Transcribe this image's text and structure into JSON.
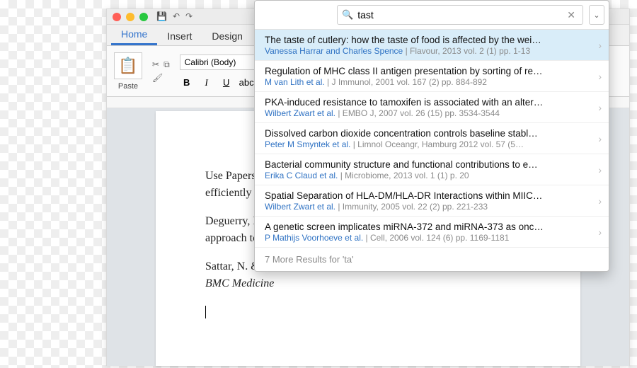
{
  "window": {
    "tabs": [
      "Home",
      "Insert",
      "Design"
    ],
    "active_tab": 0,
    "paste_label": "Paste",
    "font_name": "Calibri (Body)",
    "formats": {
      "bold": "B",
      "italic": "I",
      "underline": "U"
    }
  },
  "document": {
    "p1": "Use Papers an",
    "p2": "efficiently (Na",
    "p3": "Deguerry, M.,",
    "p4": "approach to e",
    "p5": "Sattar, N. & Gi",
    "p6_em": "BMC Medicine"
  },
  "search": {
    "query": "tast",
    "placeholder": "",
    "more_label": "7 More Results for 'ta'"
  },
  "results": [
    {
      "title": "The taste of cutlery: how the taste of food is affected by the wei…",
      "authors": "Vanessa Harrar and Charles Spence",
      "meta": "Flavour, 2013 vol. 2 (1) pp. 1-13",
      "selected": true
    },
    {
      "title": "Regulation of MHC class II antigen presentation by sorting of re…",
      "authors": "M van Lith et al.",
      "meta": "J Immunol, 2001 vol. 167 (2) pp. 884-892"
    },
    {
      "title": "PKA-induced resistance to tamoxifen is associated with an alter…",
      "authors": "Wilbert Zwart et al.",
      "meta": "EMBO J, 2007 vol. 26 (15) pp. 3534-3544"
    },
    {
      "title": "Dissolved carbon dioxide concentration controls baseline stabl…",
      "authors": "Peter M Smyntek et al.",
      "meta": "Limnol Oceangr, Hamburg 2012 vol. 57 (5…"
    },
    {
      "title": "Bacterial community structure and functional contributions to e…",
      "authors": "Erika C Claud et al.",
      "meta": "Microbiome, 2013 vol. 1 (1) p. 20"
    },
    {
      "title": "Spatial Separation of HLA-DM/HLA-DR Interactions within MIIC…",
      "authors": "Wilbert Zwart et al.",
      "meta": "Immunity, 2005 vol. 22 (2) pp. 221-233"
    },
    {
      "title": "A genetic screen implicates miRNA-372 and miRNA-373 as onc…",
      "authors": "P Mathijs Voorhoeve et al.",
      "meta": "Cell, 2006 vol. 124 (6) pp. 1169-1181"
    }
  ],
  "thumb_colors": [
    "#7fa7d8",
    "#8bbf9a",
    "#e79ad0",
    "#7fa7d8",
    "#e7b56a",
    "#8bbf9a",
    "#c76a6a",
    "#7fa7d8"
  ]
}
